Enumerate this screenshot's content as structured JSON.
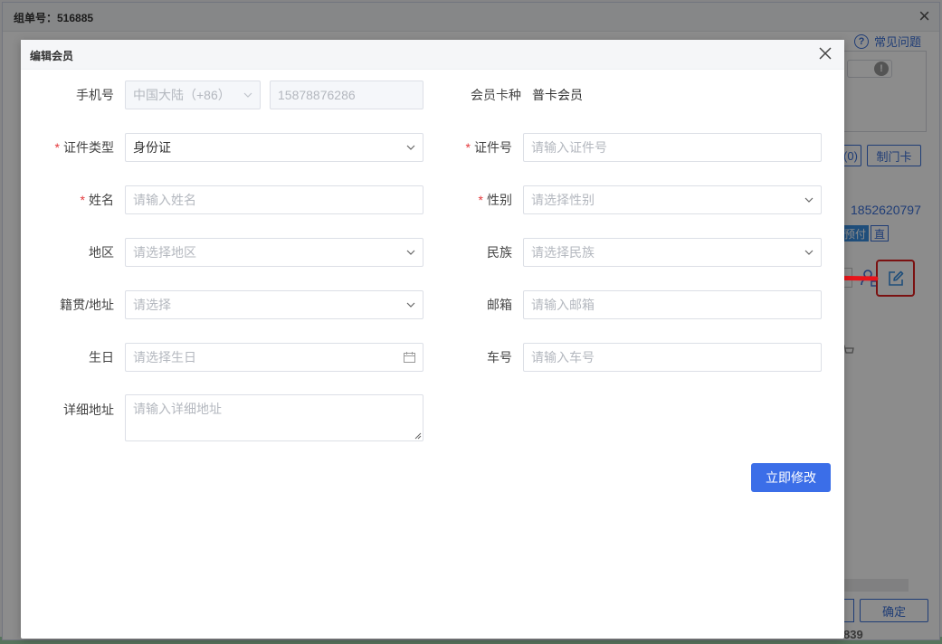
{
  "outer": {
    "title": "组单号：516885",
    "help": "常见问题",
    "help_icon": "?",
    "pill_icon": "!",
    "btn_count": "(0)",
    "btn_make_card": "制门卡",
    "phone_partial": "1852620797",
    "tag_prepay": "预付",
    "tag_direct": "直",
    "confirm": "确定",
    "number_partial": "839"
  },
  "modal": {
    "title": "编辑会员",
    "submit": "立即修改",
    "fields": {
      "phone": {
        "label": "手机号",
        "country": "中国大陆（+86）",
        "value": "15878876286"
      },
      "card_type": {
        "label": "会员卡种",
        "value": "普卡会员"
      },
      "id_type": {
        "label": "证件类型",
        "value": "身份证",
        "required": "*"
      },
      "id_number": {
        "label": "证件号",
        "placeholder": "请输入证件号",
        "required": "*"
      },
      "name": {
        "label": "姓名",
        "placeholder": "请输入姓名",
        "required": "*"
      },
      "gender": {
        "label": "性别",
        "placeholder": "请选择性别",
        "required": "*"
      },
      "region": {
        "label": "地区",
        "placeholder": "请选择地区"
      },
      "ethnicity": {
        "label": "民族",
        "placeholder": "请选择民族"
      },
      "origin": {
        "label": "籍贯/地址",
        "placeholder": "请选择"
      },
      "email": {
        "label": "邮箱",
        "placeholder": "请输入邮箱"
      },
      "birthday": {
        "label": "生日",
        "placeholder": "请选择生日"
      },
      "car_number": {
        "label": "车号",
        "placeholder": "请输入车号"
      },
      "address": {
        "label": "详细地址",
        "placeholder": "请输入详细地址"
      }
    }
  },
  "colors": {
    "primary": "#3b6ee8",
    "required": "#e4393c",
    "highlight": "#e02020",
    "placeholder": "#b4b8bf"
  },
  "icons": [
    "close-icon",
    "chevron-down-icon",
    "calendar-icon",
    "edit-icon",
    "user-lock-icon",
    "question-circle-icon",
    "arrow-left-icon"
  ]
}
